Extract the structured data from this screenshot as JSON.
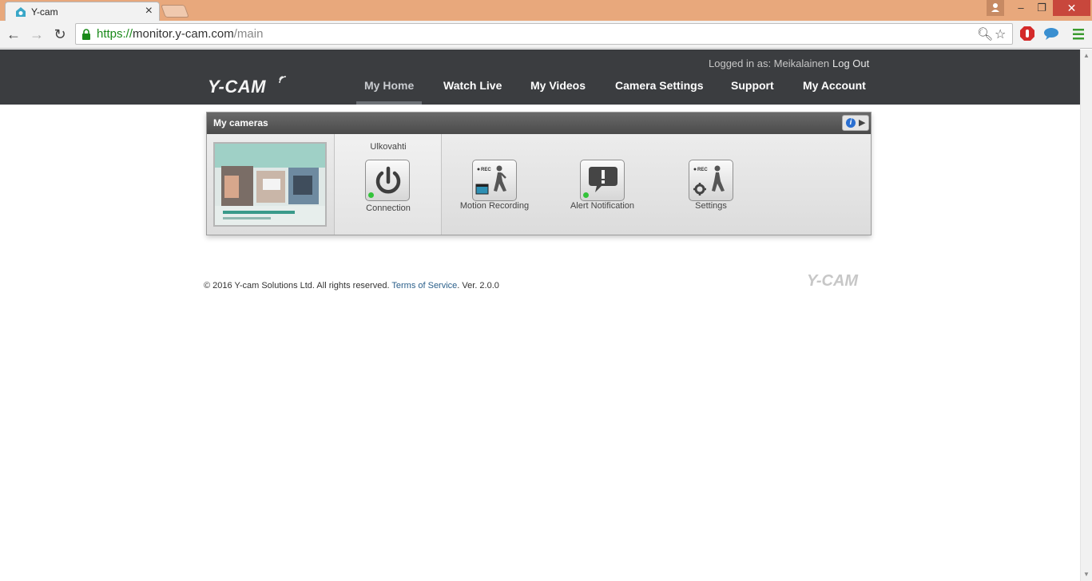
{
  "browser": {
    "tab_title": "Y-cam",
    "url_scheme": "https://",
    "url_host": "monitor.y-cam.com",
    "url_path": "/main"
  },
  "header": {
    "logo_text": "Y-CAM",
    "logged_in_label": "Logged in as: Meikalainen",
    "logout_label": "Log Out",
    "nav": [
      "My Home",
      "Watch Live",
      "My Videos",
      "Camera Settings",
      "Support",
      "My Account"
    ],
    "active_nav": "My Home"
  },
  "panel": {
    "title": "My cameras",
    "camera": {
      "name": "Ulkovahti",
      "connection_label": "Connection",
      "connection_status": "online"
    },
    "actions": [
      {
        "label": "Motion Recording",
        "icon": "motion-recording-icon"
      },
      {
        "label": "Alert Notification",
        "icon": "alert-notification-icon",
        "status": "on"
      },
      {
        "label": "Settings",
        "icon": "recording-settings-icon"
      }
    ]
  },
  "footer": {
    "copyright": "© 2016 Y-cam Solutions Ltd. All rights reserved.",
    "terms_label": "Terms of Service",
    "version": ". Ver. 2.0.0",
    "logo_text": "Y-CAM"
  },
  "colors": {
    "header_bg": "#3b3d40",
    "status_green": "#33c33a",
    "link": "#2a5f8a"
  }
}
